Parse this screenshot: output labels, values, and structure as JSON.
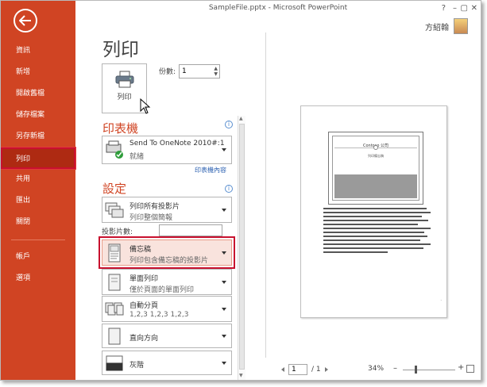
{
  "window": {
    "title": "SampleFile.pptx - Microsoft PowerPoint",
    "user_name": "方紹翰"
  },
  "sidebar": {
    "items": [
      {
        "label": "資訊"
      },
      {
        "label": "新增"
      },
      {
        "label": "開啟舊檔"
      },
      {
        "label": "儲存檔案"
      },
      {
        "label": "另存新檔"
      },
      {
        "label": "列印"
      },
      {
        "label": "共用"
      },
      {
        "label": "匯出"
      },
      {
        "label": "關閉"
      },
      {
        "label": "帳戶"
      },
      {
        "label": "選項"
      }
    ]
  },
  "print": {
    "title": "列印",
    "print_button": "列印",
    "copies_label": "份數:",
    "copies_value": "1"
  },
  "printer": {
    "heading": "印表機",
    "name": "Send To OneNote 2010#:1",
    "status": "就緒",
    "properties_link": "印表機內容"
  },
  "settings": {
    "heading": "設定",
    "slides_label": "投影片數:",
    "slides_value": "",
    "dropdowns": [
      {
        "t1": "列印所有投影片",
        "t2": "列印整個簡報"
      },
      {
        "t1": "備忘稿",
        "t2": "列印包含備忘稿的投影片"
      },
      {
        "t1": "單面列印",
        "t2": "僅於頁面的單面列印"
      },
      {
        "t1": "自動分頁",
        "t2": "1,2,3    1,2,3    1,2,3"
      },
      {
        "t1": "直向方向",
        "t2": ""
      },
      {
        "t1": "灰階",
        "t2": ""
      }
    ]
  },
  "preview": {
    "slide_title": "Contoso 公司",
    "slide_subtitle": "列印備忘稿",
    "current_page": "1",
    "total_pages": "/ 1",
    "zoom": "34%"
  },
  "colors": {
    "accent": "#d04423",
    "highlight": "#c8102e"
  }
}
